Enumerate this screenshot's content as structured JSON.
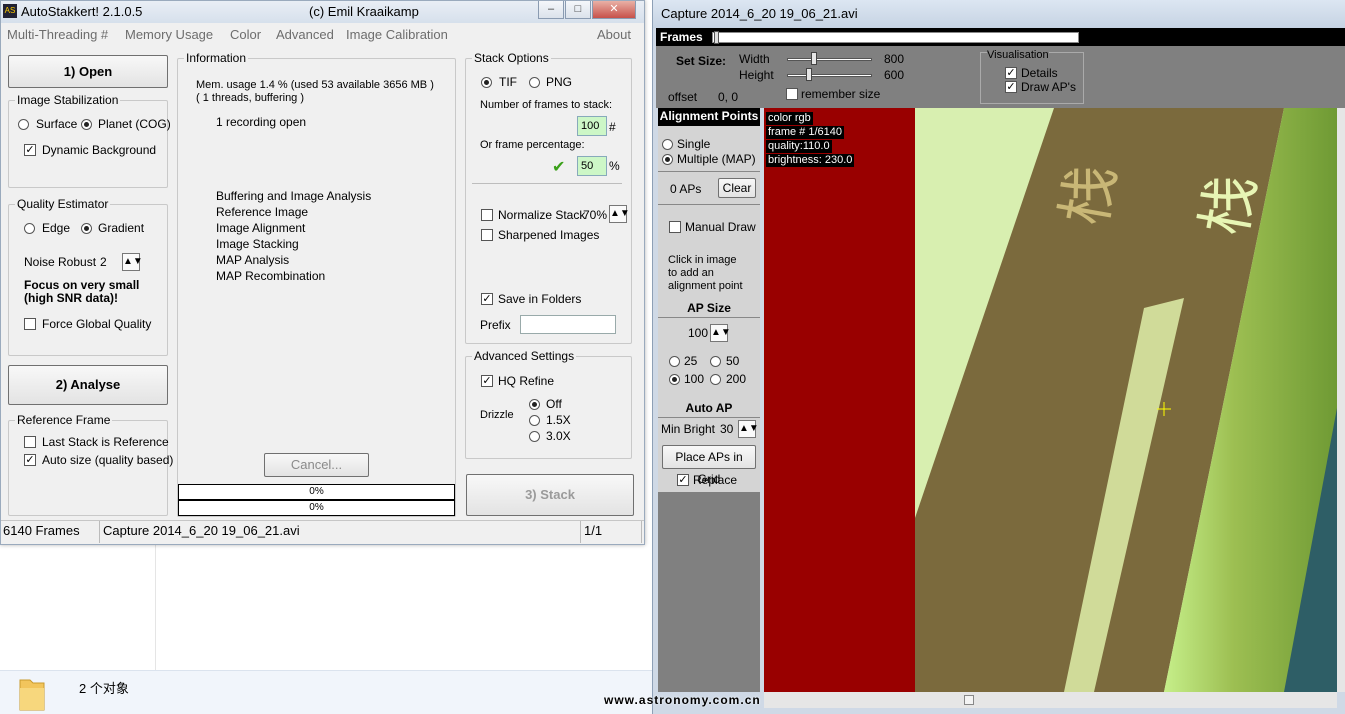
{
  "explorer": {
    "status": "2 个对象"
  },
  "as": {
    "title": "AutoStakkert! 2.1.0.5",
    "author": "(c) Emil Kraaikamp",
    "menu": [
      "Multi-Threading #",
      "Memory Usage",
      "Color",
      "Advanced",
      "Image Calibration",
      "About"
    ],
    "open_btn": "1) Open",
    "analyse_btn": "2) Analyse",
    "stack_btn": "3) Stack",
    "cancel_btn": "Cancel...",
    "stab": {
      "title": "Image Stabilization",
      "surface": "Surface",
      "planet": "Planet (COG)",
      "dynbg": "Dynamic Background"
    },
    "qe": {
      "title": "Quality Estimator",
      "edge": "Edge",
      "gradient": "Gradient",
      "noise_label": "Noise Robust",
      "noise_val": "2",
      "focus1": "Focus on very small",
      "focus2": "(high SNR data)!",
      "force": "Force Global Quality"
    },
    "ref": {
      "title": "Reference Frame",
      "last": "Last Stack is Reference",
      "auto": "Auto size (quality based)"
    },
    "info": {
      "title": "Information",
      "mem": "Mem. usage 1.4 %  (used 53 available 3656 MB )",
      "threads": "( 1 threads, buffering )",
      "rec": "1 recording open",
      "steps": [
        "Buffering and Image Analysis",
        "Reference Image",
        "Image Alignment",
        "Image Stacking",
        "MAP Analysis",
        "MAP Recombination"
      ],
      "p1": "0%",
      "p2": "0%"
    },
    "stack": {
      "title": "Stack Options",
      "tif": "TIF",
      "png": "PNG",
      "nframes_label": "Number of frames to stack:",
      "nframes": "100",
      "hash": "#",
      "pct_label": "Or frame percentage:",
      "pct": "50",
      "pct_sym": "%",
      "normalize": "Normalize Stack",
      "normalize_val": "70%",
      "sharpened": "Sharpened Images",
      "savefolders": "Save in Folders",
      "prefix": "Prefix"
    },
    "adv": {
      "title": "Advanced Settings",
      "hq": "HQ Refine",
      "drizzle": "Drizzle",
      "off": "Off",
      "d15": "1.5X",
      "d30": "3.0X"
    },
    "status": {
      "frames": "6140 Frames",
      "file": "Capture 2014_6_20 19_06_21.avi",
      "page": "1/1"
    }
  },
  "cap": {
    "title": "Capture 2014_6_20 19_06_21.avi",
    "frames_label": "Frames",
    "setsize": "Set Size:",
    "width_label": "Width",
    "width_val": "800",
    "height_label": "Height",
    "height_val": "600",
    "remember": "remember size",
    "offset_label": "offset",
    "offset_val": "0, 0",
    "vis": {
      "title": "Visualisation",
      "details": "Details",
      "drawap": "Draw AP's"
    },
    "ap": {
      "hdr": "Alignment Points",
      "single": "Single",
      "multiple": "Multiple (MAP)",
      "count": "0 APs",
      "clear": "Clear",
      "manual": "Manual Draw",
      "hint1": "Click in image",
      "hint2": "to add an",
      "hint3": "alignment point",
      "apsize_hdr": "AP Size",
      "apsize": "100",
      "s25": "25",
      "s50": "50",
      "s100": "100",
      "s200": "200",
      "autoap_hdr": "Auto AP",
      "minbright_label": "Min Bright",
      "minbright": "30",
      "placegrid": "Place APs in Grid",
      "replace": "Replace"
    },
    "overlay": {
      "l1": "color rgb",
      "l2": "frame # 1/6140",
      "l3": "quality:110.0",
      "l4": "brightness: 230.0"
    },
    "watermark": "www.astronomy.com.cn"
  }
}
